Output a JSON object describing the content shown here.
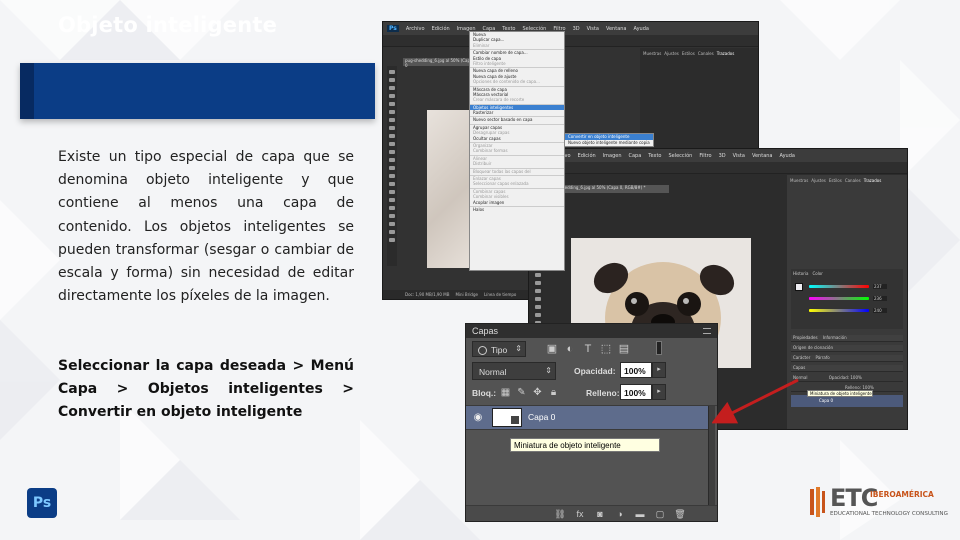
{
  "slide": {
    "title": "Objeto inteligente",
    "paragraph": "Existe un tipo especial de capa que se denomina objeto inteligente y que contiene al menos una capa de contenido. Los objetos inteligentes se pueden transformar (sesgar o cambiar de escala y forma) sin necesidad de editar directamente los píxeles de la imagen.",
    "instruction": "Seleccionar la capa deseada > Menú Capa > Objetos inteligentes > Convertir en objeto inteligente",
    "ps_logo_text": "Ps",
    "brand": {
      "mark": "ETC",
      "region": "IBEROAMÉRICA",
      "tagline": "EDUCATIONAL TECHNOLOGY CONSULTING"
    },
    "colors": {
      "title_bar": "#0b3d86",
      "accent": "#c8541b",
      "arrow": "#c41e1e",
      "selection": "#3b80d0"
    }
  },
  "screenshot1": {
    "app_badge": "Ps",
    "menu": [
      "Archivo",
      "Edición",
      "Imagen",
      "Capa",
      "Texto",
      "Selección",
      "Filtro",
      "3D",
      "Vista",
      "Ventana",
      "Ayuda"
    ],
    "doc_tab": "pug-shedding_6.jpg al 50% (Capa 0",
    "right_tabs": [
      "Muestras",
      "Ajustes",
      "Estilos",
      "Canales",
      "Trazados"
    ],
    "status": [
      "Doc: 1,90 MB/1,90 MB"
    ],
    "bottom_tabs": [
      "Mini Bridge",
      "Línea de tiempo"
    ],
    "capa_menu": [
      {
        "label": "Nueva",
        "state": "normal"
      },
      {
        "label": "Duplicar capa...",
        "state": "normal"
      },
      {
        "label": "Eliminar",
        "state": "disabled"
      },
      {
        "sep": true
      },
      {
        "label": "Cambiar nombre de capa...",
        "state": "normal"
      },
      {
        "label": "Estilo de capa",
        "state": "normal"
      },
      {
        "label": "Filtro inteligente",
        "state": "disabled"
      },
      {
        "sep": true
      },
      {
        "label": "Nueva capa de relleno",
        "state": "normal"
      },
      {
        "label": "Nueva capa de ajuste",
        "state": "normal"
      },
      {
        "label": "Opciones de contenido de capa...",
        "state": "disabled"
      },
      {
        "sep": true
      },
      {
        "label": "Máscara de capa",
        "state": "normal"
      },
      {
        "label": "Máscara vectorial",
        "state": "normal"
      },
      {
        "label": "Crear máscara de recorte",
        "state": "disabled"
      },
      {
        "sep": true
      },
      {
        "label": "Objetos inteligentes",
        "state": "highlight"
      },
      {
        "label": "Rasterizar",
        "state": "normal"
      },
      {
        "sep": true
      },
      {
        "label": "Nuevo sector basado en capa",
        "state": "normal"
      },
      {
        "sep": true
      },
      {
        "label": "Agrupar capas",
        "state": "normal"
      },
      {
        "label": "Desagrupar capas",
        "state": "disabled"
      },
      {
        "label": "Ocultar capas",
        "state": "normal"
      },
      {
        "sep": true
      },
      {
        "label": "Organizar",
        "state": "disabled"
      },
      {
        "label": "Combinar formas",
        "state": "disabled"
      },
      {
        "sep": true
      },
      {
        "label": "Alinear",
        "state": "disabled"
      },
      {
        "label": "Distribuir",
        "state": "disabled"
      },
      {
        "sep": true
      },
      {
        "label": "Bloquear todas las capas del",
        "state": "disabled"
      },
      {
        "sep": true
      },
      {
        "label": "Enlazar capas",
        "state": "disabled"
      },
      {
        "label": "Seleccionar capas enlazada",
        "state": "disabled"
      },
      {
        "sep": true
      },
      {
        "label": "Combinar capas",
        "state": "disabled"
      },
      {
        "label": "Combinar visibles",
        "state": "disabled"
      },
      {
        "label": "Acoplar imagen",
        "state": "normal"
      },
      {
        "sep": true
      },
      {
        "label": "Halos",
        "state": "normal"
      }
    ],
    "submenu": [
      {
        "label": "Convertir en objeto inteligente",
        "state": "highlight"
      },
      {
        "label": "Nuevo objeto inteligente mediante copia",
        "state": "normal"
      }
    ]
  },
  "screenshot2": {
    "app_badge": "Ps",
    "menu": [
      "Archivo",
      "Edición",
      "Imagen",
      "Capa",
      "Texto",
      "Selección",
      "Filtro",
      "3D",
      "Vista",
      "Ventana",
      "Ayuda"
    ],
    "doc_tab": "pug-shedding_6.jpg al 50% (Capa 0, RGB/8#) *",
    "right_tabs": [
      "Muestras",
      "Ajustes",
      "Estilos",
      "Canales",
      "Trazados"
    ],
    "color_panel_tabs": [
      "Historia",
      "Color"
    ],
    "rgb_values": [
      "237",
      "236",
      "240"
    ],
    "panel_rows": [
      "Propiedades",
      "Información",
      "Origen de clonación",
      "Carácter",
      "Párrafo",
      "Capas"
    ],
    "layer_name": "Capa 0",
    "tooltip": "Miniatura de objeto inteligente",
    "opacity_label": "Opacidad:",
    "opacity_value": "100%",
    "fill_label": "Relleno:",
    "fill_value": "100%",
    "blend_mode": "Normal"
  },
  "layers_panel": {
    "title": "Capas",
    "kind_filter": "Tipo",
    "blend_mode": "Normal",
    "opacity_label": "Opacidad:",
    "opacity_value": "100%",
    "lock_label": "Bloq.:",
    "fill_label": "Relleno:",
    "fill_value": "100%",
    "layer_name": "Capa 0",
    "tooltip": "Miniatura de objeto inteligente"
  }
}
